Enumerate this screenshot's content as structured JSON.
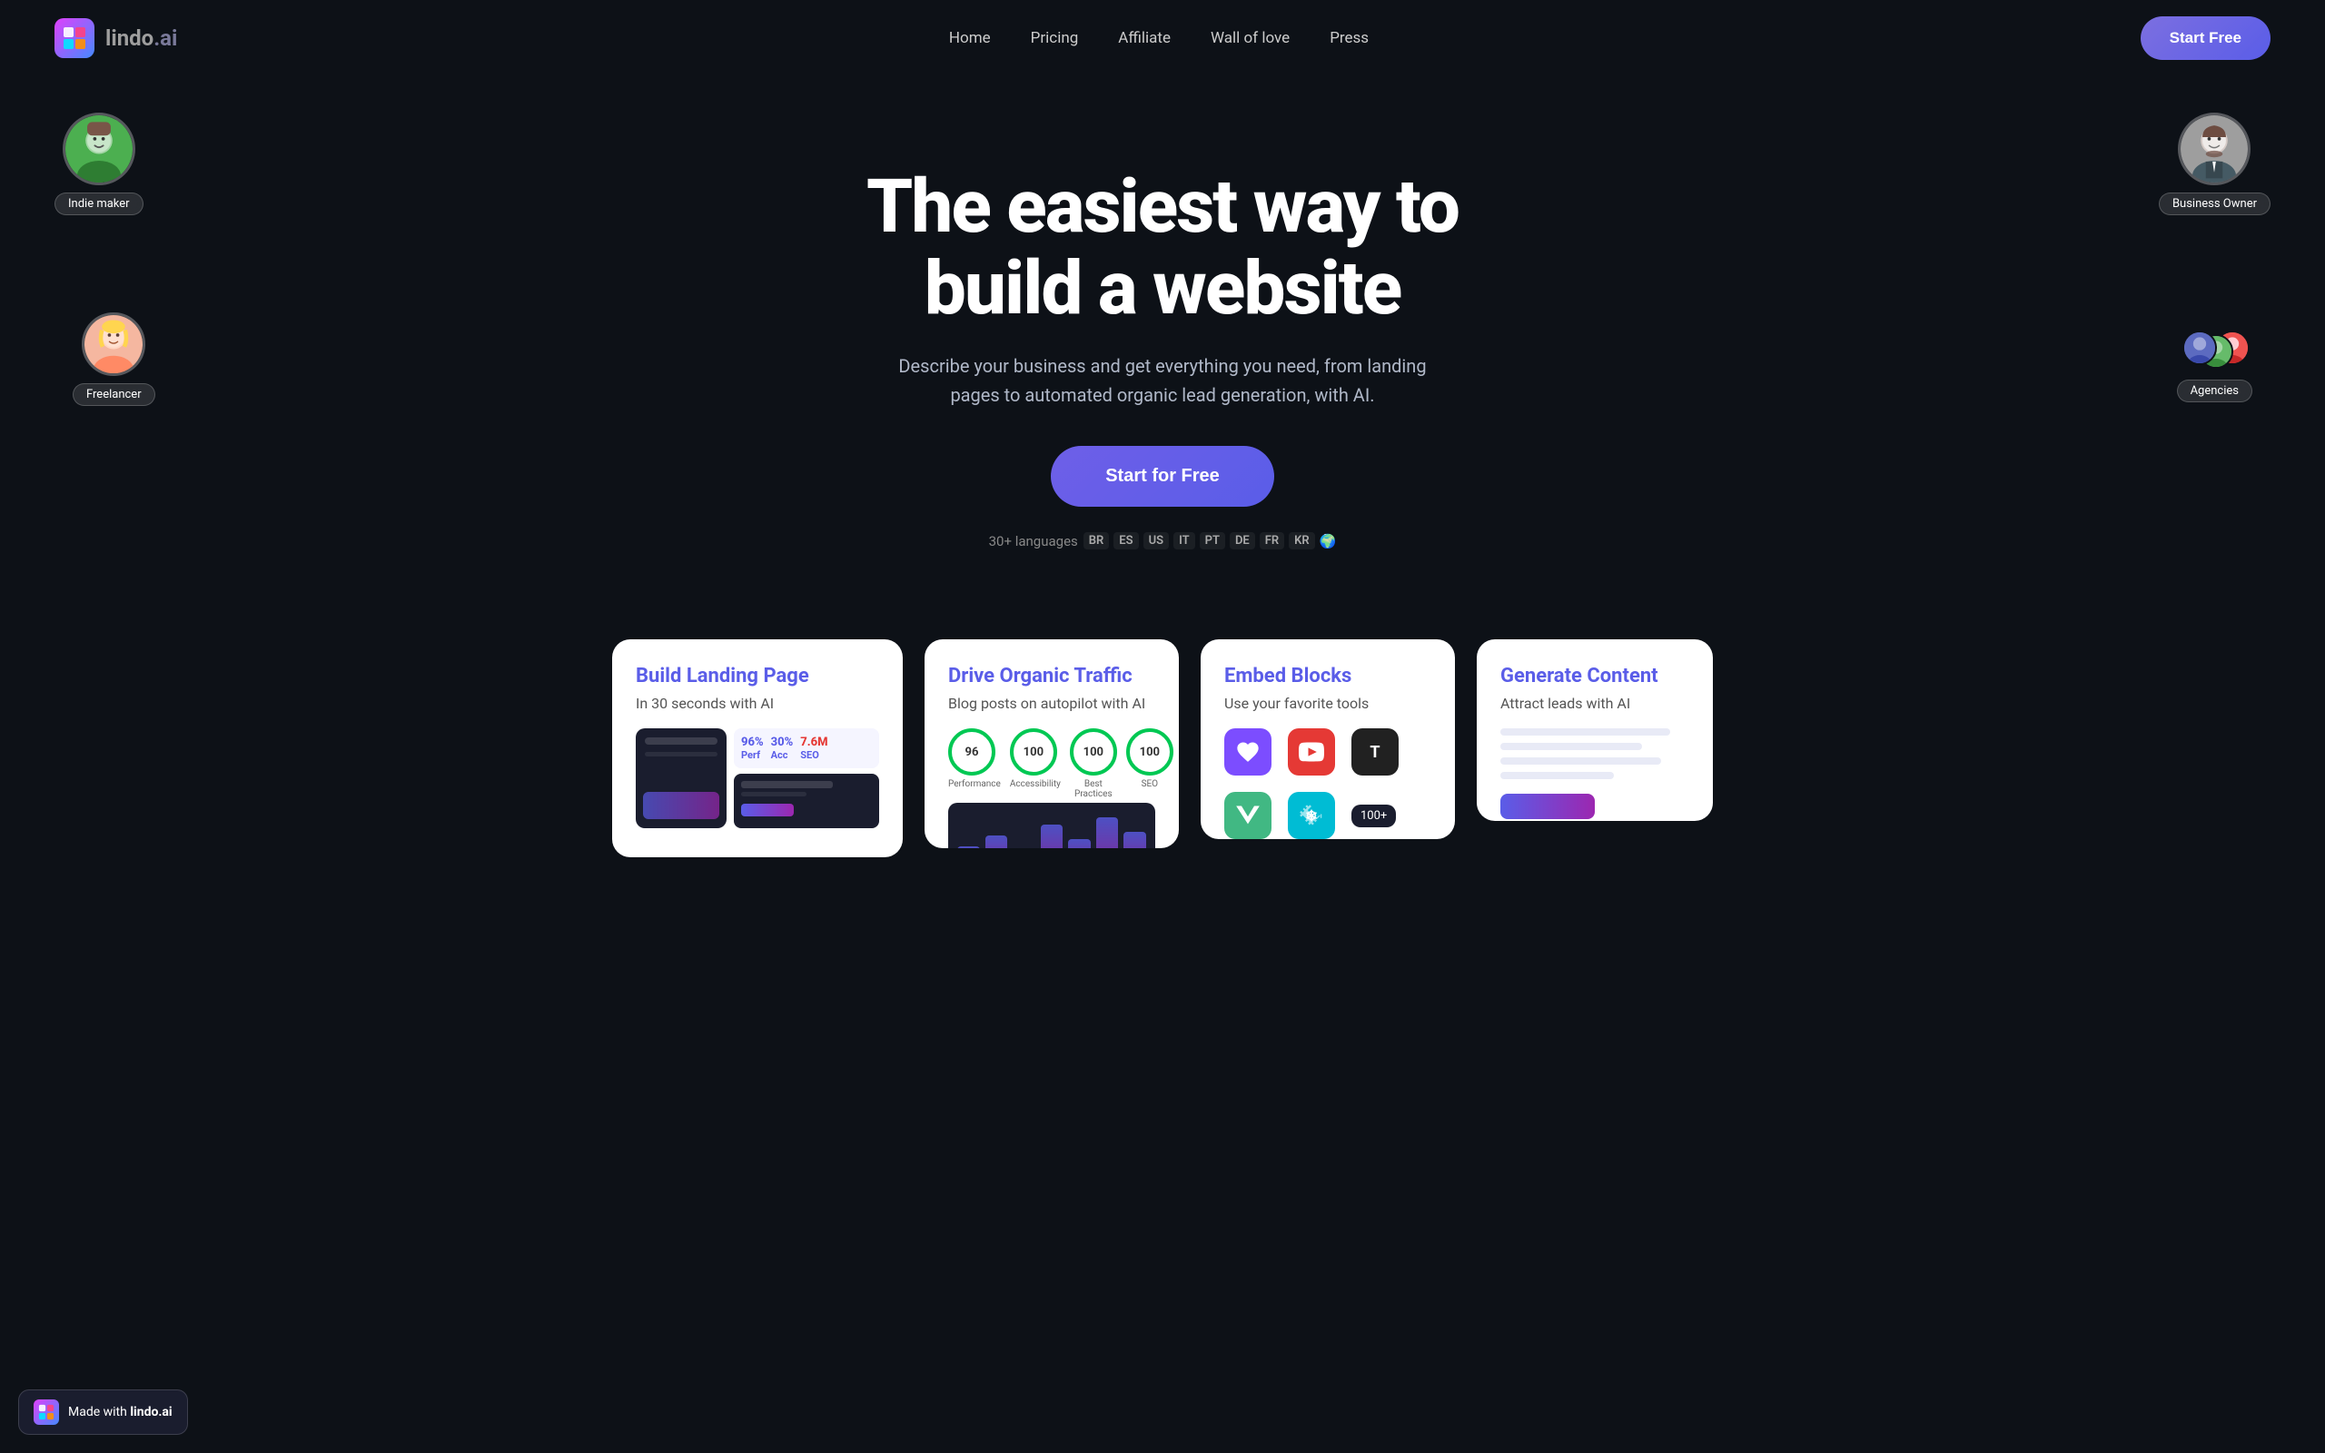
{
  "nav": {
    "logo_name": "lindo",
    "logo_suffix": ".ai",
    "links": [
      {
        "label": "Home",
        "id": "home"
      },
      {
        "label": "Pricing",
        "id": "pricing"
      },
      {
        "label": "Affiliate",
        "id": "affiliate"
      },
      {
        "label": "Wall of love",
        "id": "wall-of-love"
      },
      {
        "label": "Press",
        "id": "press"
      }
    ],
    "cta_label": "Start Free"
  },
  "hero": {
    "headline_line1": "The easiest way to",
    "headline_line2": "build a website",
    "subtext": "Describe your business and get everything you need, from landing pages to automated organic lead generation, with AI.",
    "cta_label": "Start for Free",
    "langs_label": "30+ languages",
    "lang_tags": [
      "BR",
      "ES",
      "US",
      "IT",
      "PT",
      "DE",
      "FR",
      "KR"
    ]
  },
  "avatars": {
    "indie": {
      "label": "Indie maker"
    },
    "freelancer": {
      "label": "Freelancer"
    },
    "business": {
      "label": "Business Owner"
    },
    "agencies": {
      "label": "Agencies"
    }
  },
  "cards": {
    "landing": {
      "title": "Build Landing Page",
      "subtitle": "In 30 seconds with AI"
    },
    "traffic": {
      "title": "Drive Organic Traffic",
      "subtitle": "Blog posts on autopilot with AI"
    },
    "embed": {
      "title": "Embed Blocks",
      "subtitle": "Use your favorite tools",
      "badge": "100+"
    },
    "generate": {
      "title": "Generate Content",
      "subtitle": "Attract leads with AI"
    }
  },
  "seo_scores": [
    {
      "label": "Performance",
      "value": 96
    },
    {
      "label": "Accessibility",
      "value": 100
    },
    {
      "label": "Best Practices",
      "value": 100
    },
    {
      "label": "SEO",
      "value": 100
    }
  ],
  "made_badge": {
    "prefix": "Made with ",
    "brand": "lindo.ai"
  }
}
